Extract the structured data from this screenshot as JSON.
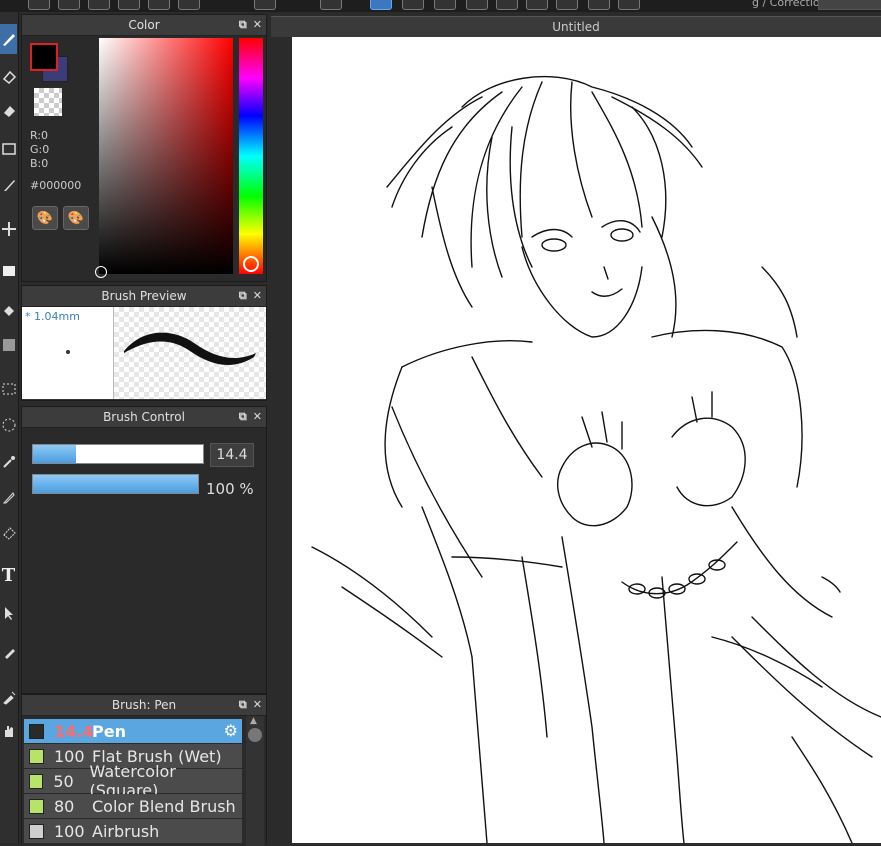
{
  "toolbar_top": {
    "correction_label": "g / Correction"
  },
  "tools": [
    {
      "name": "pen-tool-icon",
      "active": true
    },
    {
      "name": "eraser-tool-icon"
    },
    {
      "name": "fill-eraser-tool-icon"
    },
    {
      "name": "rectangle-tool-icon"
    },
    {
      "name": "brush-tool-icon"
    },
    {
      "name": "move-tool-icon"
    },
    {
      "name": "fill-rect-tool-icon"
    },
    {
      "name": "bucket-tool-icon"
    },
    {
      "name": "gradient-tool-icon"
    },
    {
      "name": "rect-select-icon"
    },
    {
      "name": "lasso-select-icon"
    },
    {
      "name": "magic-wand-icon"
    },
    {
      "name": "select-pen-icon"
    },
    {
      "name": "select-eraser-icon"
    },
    {
      "name": "text-tool-icon"
    },
    {
      "name": "operation-tool-icon"
    },
    {
      "name": "dropper-brush-icon"
    },
    {
      "name": "eyedropper-icon"
    },
    {
      "name": "hand-tool-icon"
    }
  ],
  "color_panel": {
    "title": "Color",
    "r": "R:0",
    "g": "G:0",
    "b": "B:0",
    "hex": "#000000",
    "foreground": "#000000",
    "background": "#3a3d7a"
  },
  "brush_preview": {
    "title": "Brush Preview",
    "size": "* 1.04mm"
  },
  "brush_control": {
    "title": "Brush Control",
    "size_value": "14.4",
    "size_fraction": 0.25,
    "opacity": "100 %",
    "opacity_fraction": 1.0
  },
  "brush_list": {
    "title": "Brush: Pen",
    "items": [
      {
        "size": "14.4",
        "name": "Pen",
        "color": "#2a2a2a",
        "selected": true
      },
      {
        "size": "100",
        "name": "Flat Brush (Wet)",
        "color": "#b7e36a"
      },
      {
        "size": "50",
        "name": "Watercolor (Square)",
        "color": "#b7e36a"
      },
      {
        "size": "80",
        "name": "Color Blend Brush",
        "color": "#b7e36a"
      },
      {
        "size": "100",
        "name": "Airbrush",
        "color": "#cfcfcf"
      }
    ]
  },
  "document": {
    "title": "Untitled"
  }
}
